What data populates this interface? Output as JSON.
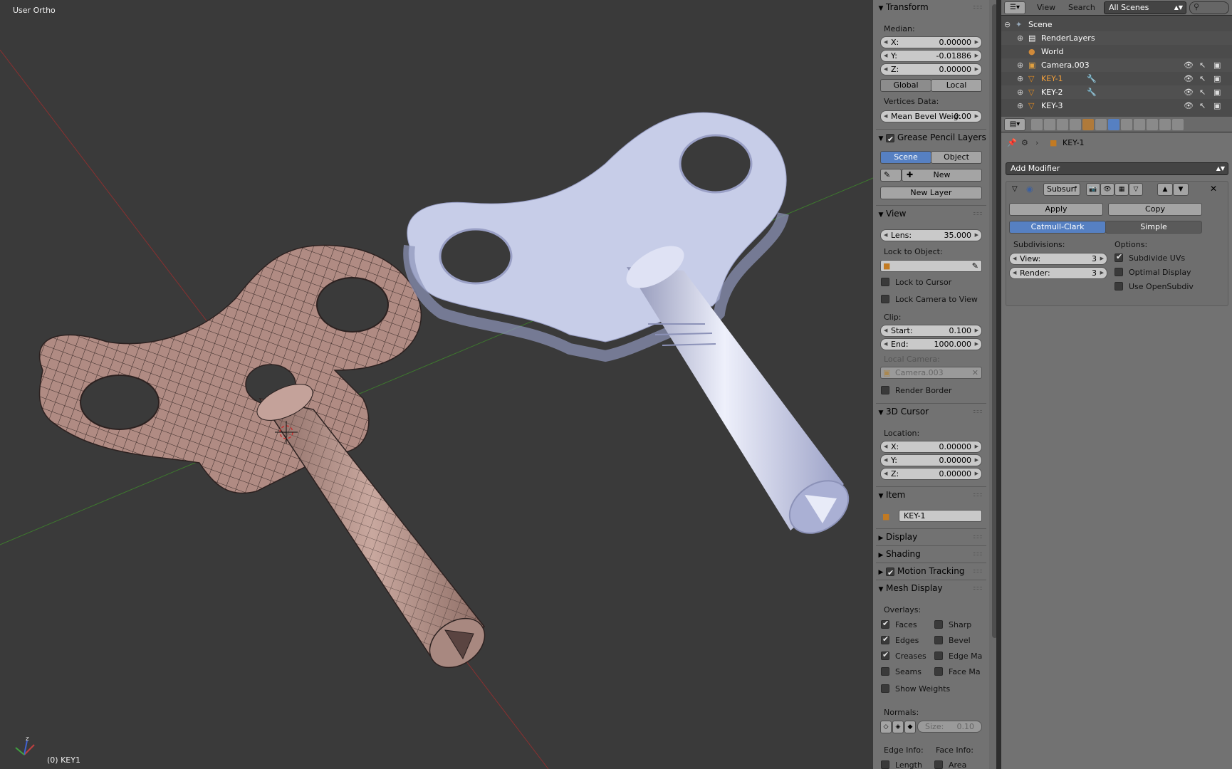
{
  "viewport": {
    "title": "User Ortho",
    "status": "(0) KEY1"
  },
  "npanel": {
    "transform": {
      "header": "Transform",
      "median_label": "Median:",
      "x_label": "X:",
      "x": "0.00000",
      "y_label": "Y:",
      "y": "-0.01886",
      "z_label": "Z:",
      "z": "0.00000",
      "global": "Global",
      "local": "Local",
      "vertices_data": "Vertices Data:",
      "bevel_label": "Mean Bevel Weig:",
      "bevel": "0.00"
    },
    "grease": {
      "header": "Grease Pencil Layers",
      "scene": "Scene",
      "object": "Object",
      "new": "New",
      "new_layer": "New Layer"
    },
    "view": {
      "header": "View",
      "lens_label": "Lens:",
      "lens": "35.000",
      "lock_object": "Lock to Object:",
      "lock_cursor": "Lock to Cursor",
      "lock_camera": "Lock Camera to View",
      "clip": "Clip:",
      "start_label": "Start:",
      "start": "0.100",
      "end_label": "End:",
      "end": "1000.000",
      "local_camera": "Local Camera:",
      "camera": "Camera.003",
      "render_border": "Render Border"
    },
    "cursor": {
      "header": "3D Cursor",
      "location": "Location:",
      "x_label": "X:",
      "x": "0.00000",
      "y_label": "Y:",
      "y": "0.00000",
      "z_label": "Z:",
      "z": "0.00000"
    },
    "item": {
      "header": "Item",
      "name": "KEY-1"
    },
    "display": "Display",
    "shading": "Shading",
    "motion_tracking": "Motion Tracking",
    "mesh_display": {
      "header": "Mesh Display",
      "overlays": "Overlays:",
      "faces": "Faces",
      "edges": "Edges",
      "creases": "Creases",
      "seams": "Seams",
      "sharp": "Sharp",
      "bevel": "Bevel",
      "edge_ma": "Edge Ma",
      "face_ma": "Face Ma",
      "show_weights": "Show Weights",
      "normals": "Normals:",
      "size_label": "Size:",
      "size": "0.10",
      "edge_info": "Edge Info:",
      "face_info": "Face Info:",
      "length": "Length",
      "area": "Area"
    }
  },
  "outliner": {
    "menu_view": "View",
    "menu_search": "Search",
    "scene_select": "All Scenes",
    "rows": [
      "Scene",
      "RenderLayers",
      "World",
      "Camera.003",
      "KEY-1",
      "KEY-2",
      "KEY-3"
    ]
  },
  "properties": {
    "breadcrumb": "KEY-1",
    "add_modifier": "Add Modifier",
    "modifier_name": "Subsurf",
    "apply": "Apply",
    "copy": "Copy",
    "catmull": "Catmull-Clark",
    "simple": "Simple",
    "subdivisions": "Subdivisions:",
    "view_label": "View:",
    "view_val": "3",
    "render_label": "Render:",
    "render_val": "3",
    "options": "Options:",
    "subdivide_uvs": "Subdivide UVs",
    "optimal_display": "Optimal Display",
    "use_opensubdiv": "Use OpenSubdiv"
  },
  "colors": {
    "selected": "#5680c2",
    "panel": "#727272",
    "viewport": "#3a3a3a",
    "wire_key": "#b8958d",
    "solid_key": "#c7cde8"
  }
}
